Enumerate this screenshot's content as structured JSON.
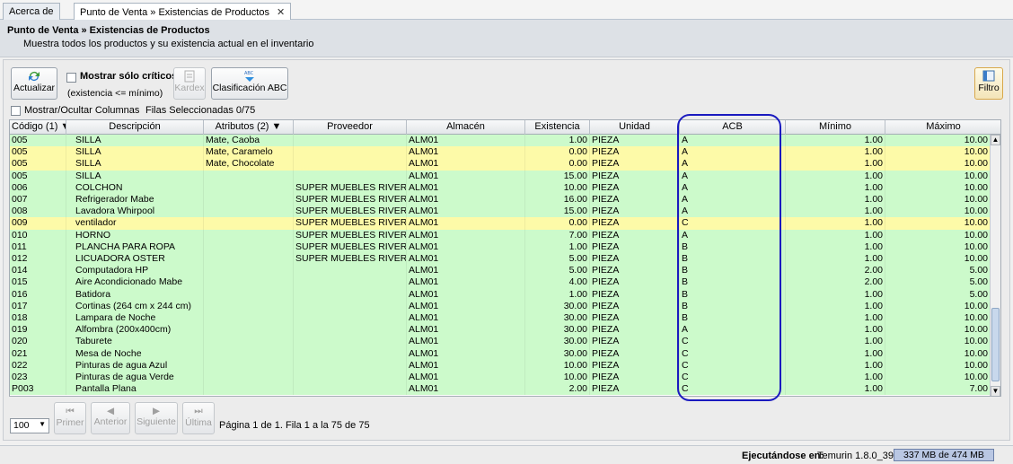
{
  "tabs": [
    {
      "label": "Acerca de",
      "active": false
    },
    {
      "label": "Punto de Venta » Existencias de Productos",
      "active": true
    }
  ],
  "header": {
    "title": "Punto de Venta » Existencias de Productos",
    "subtitle": "Muestra todos los productos y su existencia actual en el inventario"
  },
  "toolbar": {
    "refresh_label": "Actualizar",
    "critical_only_label": "Mostrar sólo críticos",
    "critical_hint": "(existencia <= mínimo)",
    "kardex_label": "Kardex",
    "abc_label": "Clasificación ABC",
    "filter_label": "Filtro"
  },
  "table_tools": {
    "toggle_columns_label": "Mostrar/Ocultar Columnas",
    "selected_rows": "Filas Seleccionadas 0/75"
  },
  "columns": [
    "Código (1) ▼",
    "Descripción",
    "Atributos (2) ▼",
    "Proveedor",
    "Almacén",
    "Existencia",
    "Unidad",
    "ACB",
    "Mínimo",
    "Máximo"
  ],
  "colors": {
    "row_green": "#ccfacb",
    "row_yellow": "#fdfaa8",
    "highlight_blue": "#1a1abf"
  },
  "rows": [
    {
      "codigo": "005",
      "descripcion": "SILLA",
      "atributos": "Mate, Caoba",
      "proveedor": "",
      "almacen": "ALM01",
      "existencia": "1.00",
      "unidad": "PIEZA",
      "acb": "A",
      "minimo": "1.00",
      "maximo": "10.00",
      "status": "green"
    },
    {
      "codigo": "005",
      "descripcion": "SILLA",
      "atributos": "Mate, Caramelo",
      "proveedor": "",
      "almacen": "ALM01",
      "existencia": "0.00",
      "unidad": "PIEZA",
      "acb": "A",
      "minimo": "1.00",
      "maximo": "10.00",
      "status": "yellow"
    },
    {
      "codigo": "005",
      "descripcion": "SILLA",
      "atributos": "Mate, Chocolate",
      "proveedor": "",
      "almacen": "ALM01",
      "existencia": "0.00",
      "unidad": "PIEZA",
      "acb": "A",
      "minimo": "1.00",
      "maximo": "10.00",
      "status": "yellow"
    },
    {
      "codigo": "005",
      "descripcion": "SILLA",
      "atributos": "",
      "proveedor": "",
      "almacen": "ALM01",
      "existencia": "15.00",
      "unidad": "PIEZA",
      "acb": "A",
      "minimo": "1.00",
      "maximo": "10.00",
      "status": "green"
    },
    {
      "codigo": "006",
      "descripcion": "COLCHON",
      "atributos": "",
      "proveedor": "SUPER MUEBLES RIVERA",
      "almacen": "ALM01",
      "existencia": "10.00",
      "unidad": "PIEZA",
      "acb": "A",
      "minimo": "1.00",
      "maximo": "10.00",
      "status": "green"
    },
    {
      "codigo": "007",
      "descripcion": "Refrigerador Mabe",
      "atributos": "",
      "proveedor": "SUPER MUEBLES RIVERA",
      "almacen": "ALM01",
      "existencia": "16.00",
      "unidad": "PIEZA",
      "acb": "A",
      "minimo": "1.00",
      "maximo": "10.00",
      "status": "green"
    },
    {
      "codigo": "008",
      "descripcion": "Lavadora Whirpool",
      "atributos": "",
      "proveedor": "SUPER MUEBLES RIVERA",
      "almacen": "ALM01",
      "existencia": "15.00",
      "unidad": "PIEZA",
      "acb": "A",
      "minimo": "1.00",
      "maximo": "10.00",
      "status": "green"
    },
    {
      "codigo": "009",
      "descripcion": "ventilador",
      "atributos": "",
      "proveedor": "SUPER MUEBLES RIVERA",
      "almacen": "ALM01",
      "existencia": "0.00",
      "unidad": "PIEZA",
      "acb": "C",
      "minimo": "1.00",
      "maximo": "10.00",
      "status": "yellow"
    },
    {
      "codigo": "010",
      "descripcion": "HORNO",
      "atributos": "",
      "proveedor": "SUPER MUEBLES RIVERA",
      "almacen": "ALM01",
      "existencia": "7.00",
      "unidad": "PIEZA",
      "acb": "A",
      "minimo": "1.00",
      "maximo": "10.00",
      "status": "green"
    },
    {
      "codigo": "011",
      "descripcion": "PLANCHA PARA ROPA",
      "atributos": "",
      "proveedor": "SUPER MUEBLES RIVERA",
      "almacen": "ALM01",
      "existencia": "1.00",
      "unidad": "PIEZA",
      "acb": "B",
      "minimo": "1.00",
      "maximo": "10.00",
      "status": "green"
    },
    {
      "codigo": "012",
      "descripcion": "LICUADORA OSTER",
      "atributos": "",
      "proveedor": "SUPER MUEBLES RIVERA",
      "almacen": "ALM01",
      "existencia": "5.00",
      "unidad": "PIEZA",
      "acb": "B",
      "minimo": "1.00",
      "maximo": "10.00",
      "status": "green"
    },
    {
      "codigo": "014",
      "descripcion": "Computadora HP",
      "atributos": "",
      "proveedor": "",
      "almacen": "ALM01",
      "existencia": "5.00",
      "unidad": "PIEZA",
      "acb": "B",
      "minimo": "2.00",
      "maximo": "5.00",
      "status": "green"
    },
    {
      "codigo": "015",
      "descripcion": "Aire Acondicionado  Mabe",
      "atributos": "",
      "proveedor": "",
      "almacen": "ALM01",
      "existencia": "4.00",
      "unidad": "PIEZA",
      "acb": "B",
      "minimo": "2.00",
      "maximo": "5.00",
      "status": "green"
    },
    {
      "codigo": "016",
      "descripcion": "Batidora",
      "atributos": "",
      "proveedor": "",
      "almacen": "ALM01",
      "existencia": "1.00",
      "unidad": "PIEZA",
      "acb": "B",
      "minimo": "1.00",
      "maximo": "5.00",
      "status": "green"
    },
    {
      "codigo": "017",
      "descripcion": "Cortinas (264 cm x 244 cm)",
      "atributos": "",
      "proveedor": "",
      "almacen": "ALM01",
      "existencia": "30.00",
      "unidad": "PIEZA",
      "acb": "B",
      "minimo": "1.00",
      "maximo": "10.00",
      "status": "green"
    },
    {
      "codigo": "018",
      "descripcion": "Lampara de Noche",
      "atributos": "",
      "proveedor": "",
      "almacen": "ALM01",
      "existencia": "30.00",
      "unidad": "PIEZA",
      "acb": "B",
      "minimo": "1.00",
      "maximo": "10.00",
      "status": "green"
    },
    {
      "codigo": "019",
      "descripcion": "Alfombra (200x400cm)",
      "atributos": "",
      "proveedor": "",
      "almacen": "ALM01",
      "existencia": "30.00",
      "unidad": "PIEZA",
      "acb": "A",
      "minimo": "1.00",
      "maximo": "10.00",
      "status": "green"
    },
    {
      "codigo": "020",
      "descripcion": "Taburete",
      "atributos": "",
      "proveedor": "",
      "almacen": "ALM01",
      "existencia": "30.00",
      "unidad": "PIEZA",
      "acb": "C",
      "minimo": "1.00",
      "maximo": "10.00",
      "status": "green"
    },
    {
      "codigo": "021",
      "descripcion": "Mesa de Noche",
      "atributos": "",
      "proveedor": "",
      "almacen": "ALM01",
      "existencia": "30.00",
      "unidad": "PIEZA",
      "acb": "C",
      "minimo": "1.00",
      "maximo": "10.00",
      "status": "green"
    },
    {
      "codigo": "022",
      "descripcion": "Pinturas de agua Azul",
      "atributos": "",
      "proveedor": "",
      "almacen": "ALM01",
      "existencia": "10.00",
      "unidad": "PIEZA",
      "acb": "C",
      "minimo": "1.00",
      "maximo": "10.00",
      "status": "green"
    },
    {
      "codigo": "023",
      "descripcion": "Pinturas de agua Verde",
      "atributos": "",
      "proveedor": "",
      "almacen": "ALM01",
      "existencia": "10.00",
      "unidad": "PIEZA",
      "acb": "C",
      "minimo": "1.00",
      "maximo": "10.00",
      "status": "green"
    },
    {
      "codigo": "P003",
      "descripcion": "Pantalla Plana",
      "atributos": "",
      "proveedor": "",
      "almacen": "ALM01",
      "existencia": "2.00",
      "unidad": "PIEZA",
      "acb": "C",
      "minimo": "1.00",
      "maximo": "7.00",
      "status": "green"
    }
  ],
  "pagination": {
    "page_size": "100",
    "first_label": "Primer",
    "prev_label": "Anterior",
    "next_label": "Siguiente",
    "last_label": "Última",
    "info": "Página 1 de 1. Fila 1 a la 75 de 75"
  },
  "status": {
    "running_label": "Ejecutándose en:",
    "runtime": "Temurin 1.8.0_392",
    "memory": "337 MB de 474 MB"
  }
}
